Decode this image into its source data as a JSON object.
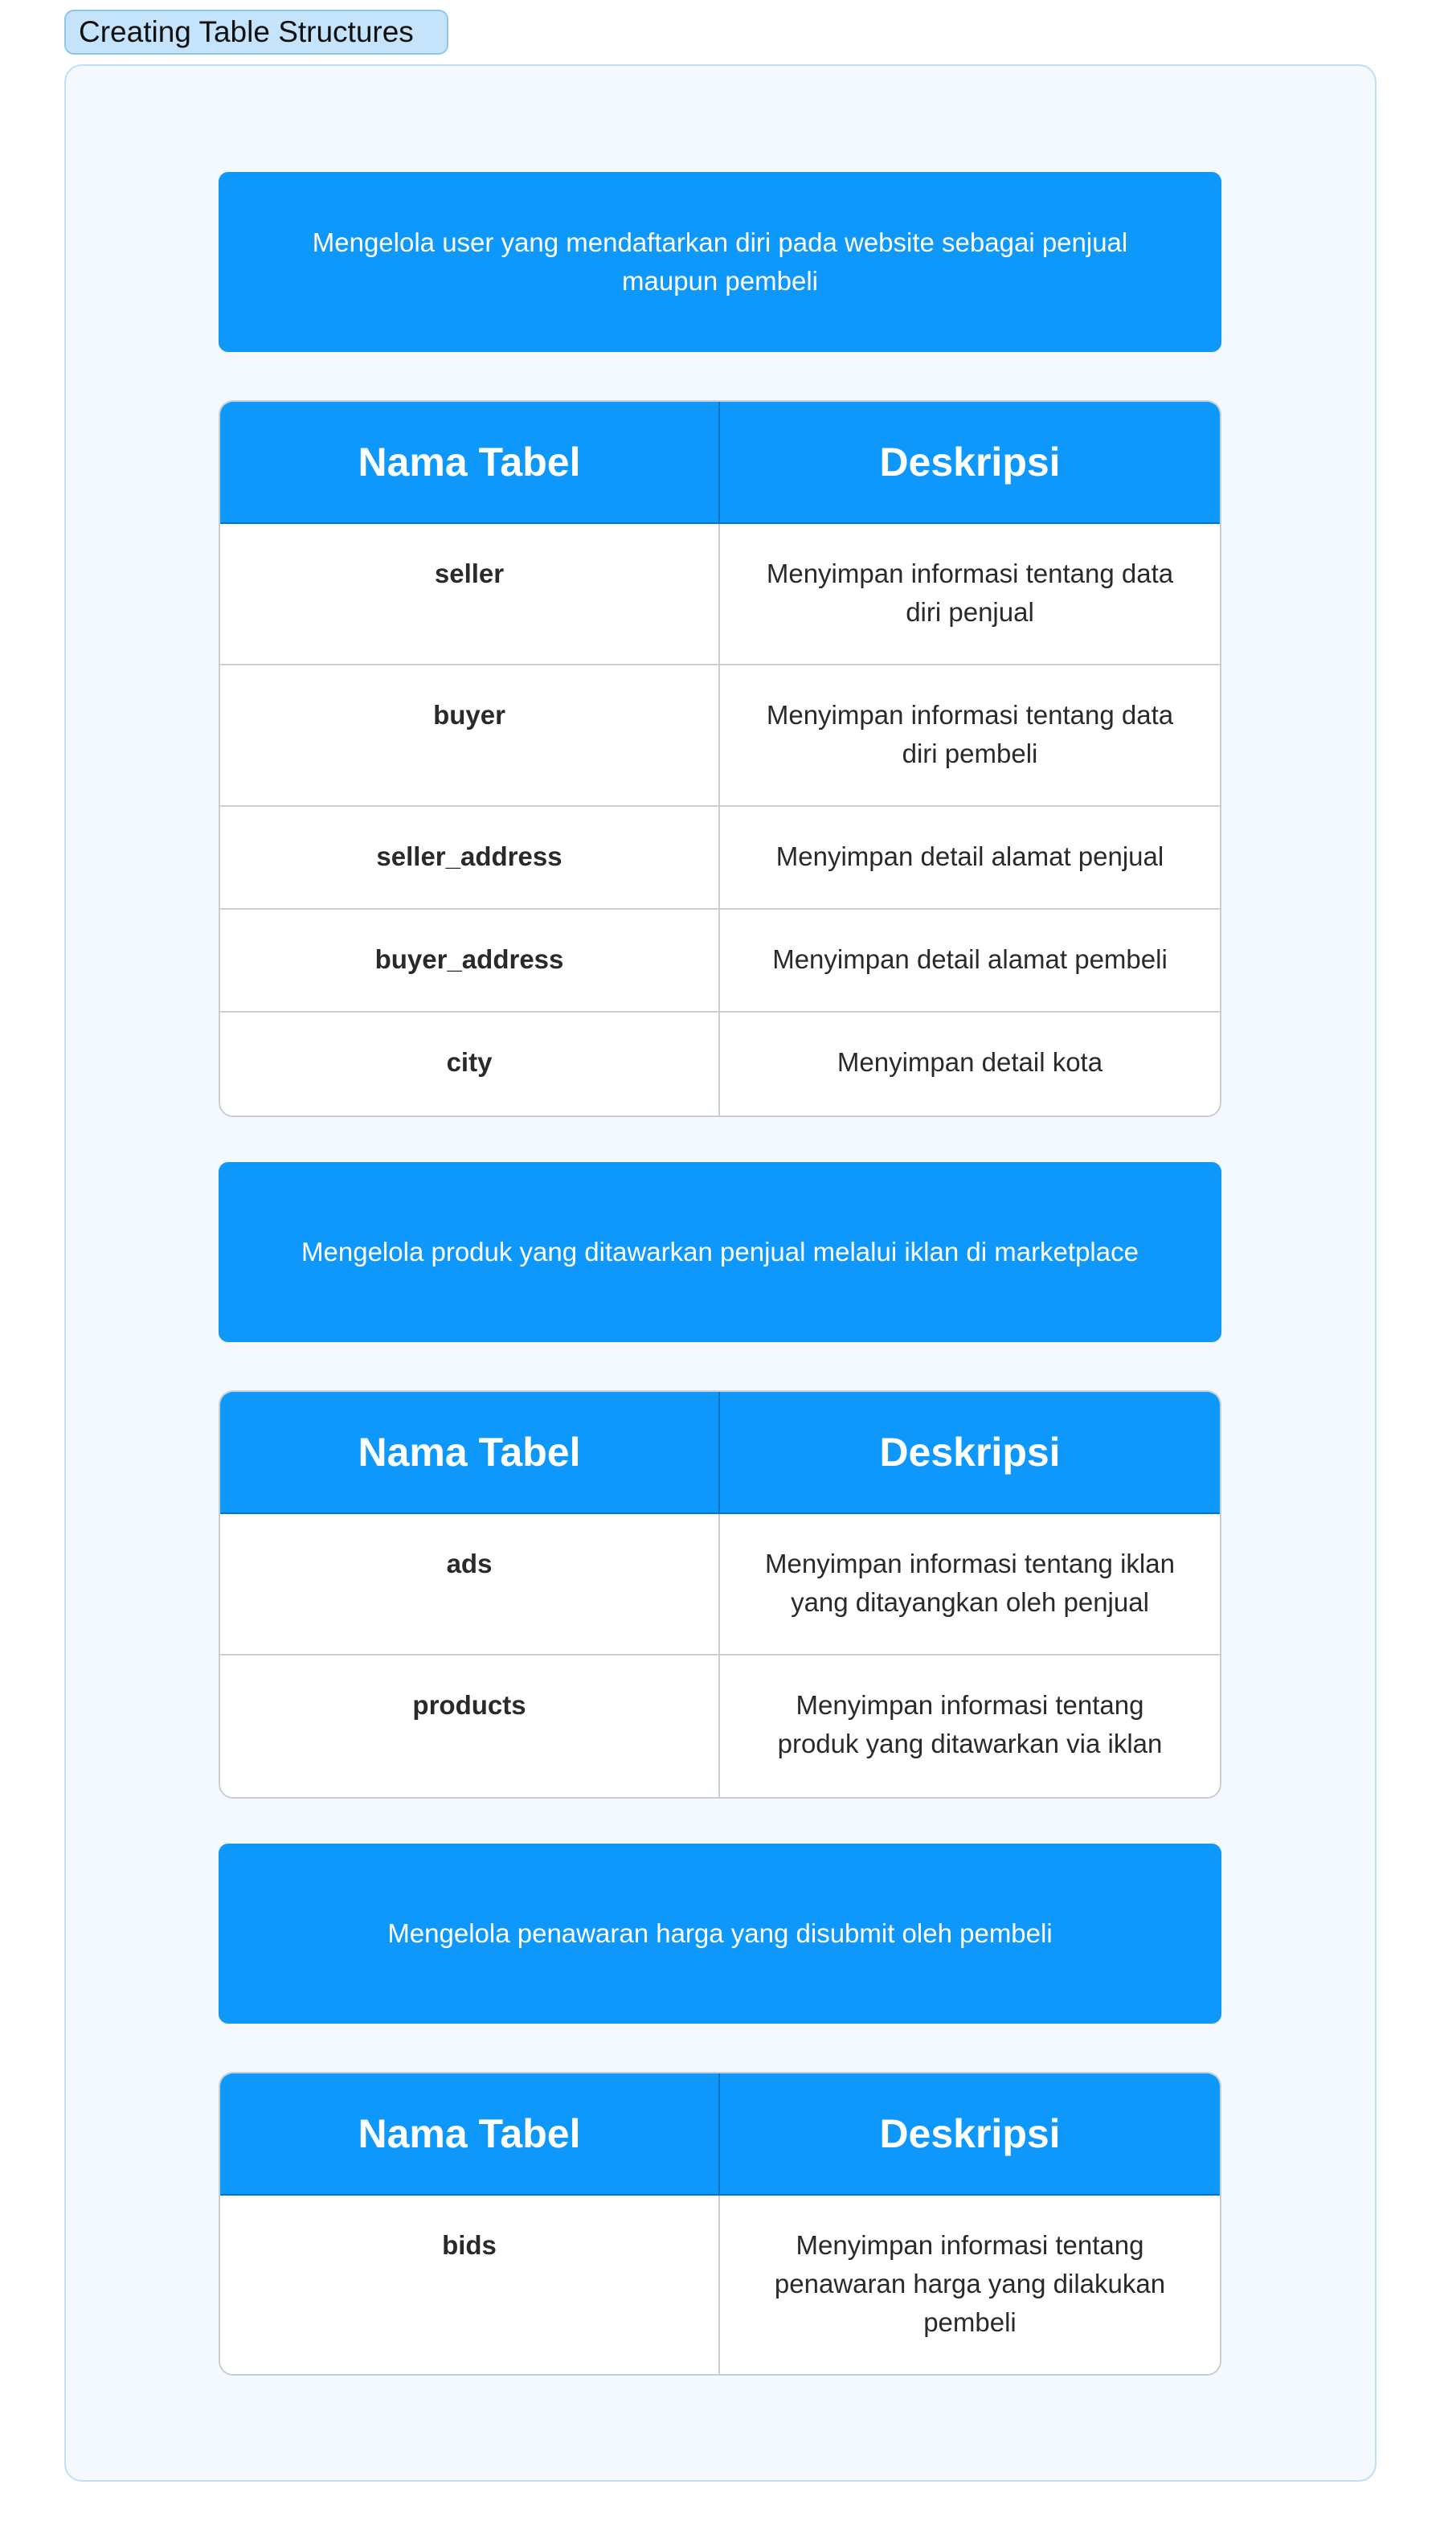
{
  "header": {
    "title": "Creating Table Structures"
  },
  "sections": [
    {
      "description": "Mengelola user yang mendaftarkan diri pada website sebagai penjual maupun pembeli",
      "table": {
        "col_name": "Nama Tabel",
        "col_desc": "Deskripsi",
        "rows": [
          {
            "name": "seller",
            "desc": "Menyimpan informasi tentang data diri penjual"
          },
          {
            "name": "buyer",
            "desc": "Menyimpan informasi tentang data diri pembeli"
          },
          {
            "name": "seller_address",
            "desc": "Menyimpan detail alamat penjual"
          },
          {
            "name": "buyer_address",
            "desc": "Menyimpan detail alamat pembeli"
          },
          {
            "name": "city",
            "desc": "Menyimpan detail kota"
          }
        ]
      }
    },
    {
      "description": "Mengelola produk yang ditawarkan penjual melalui iklan di marketplace",
      "table": {
        "col_name": "Nama Tabel",
        "col_desc": "Deskripsi",
        "rows": [
          {
            "name": "ads",
            "desc": "Menyimpan informasi tentang iklan yang ditayangkan oleh penjual"
          },
          {
            "name": "products",
            "desc": "Menyimpan informasi tentang produk yang ditawarkan via iklan"
          }
        ]
      }
    },
    {
      "description": "Mengelola penawaran harga yang disubmit oleh pembeli",
      "table": {
        "col_name": "Nama Tabel",
        "col_desc": "Deskripsi",
        "rows": [
          {
            "name": "bids",
            "desc": "Menyimpan informasi tentang penawaran harga yang dilakukan pembeli"
          }
        ]
      }
    }
  ],
  "colors": {
    "accent": "#0f98fc",
    "frame_bg": "#f3f9fe",
    "title_bg": "#c5e4fb"
  }
}
